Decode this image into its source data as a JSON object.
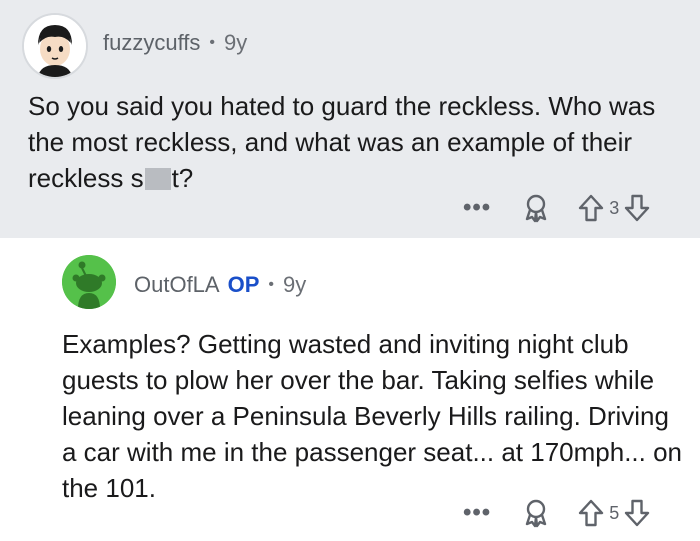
{
  "top_comment": {
    "author": "fuzzycuffs",
    "separator": "•",
    "age": "9y",
    "body_before": "So you said you hated to guard the reckless. Who was the most reckless, and what was an example of their reckless s",
    "body_after": "t?",
    "more_label": "•••",
    "vote_count": "3"
  },
  "reply_comment": {
    "author": "OutOfLA",
    "badge": "OP",
    "separator": "•",
    "age": "9y",
    "body": "Examples? Getting wasted and inviting night club guests to plow her over the bar. Taking selfies while leaning over a Peninsula Beverly Hills railing. Driving a car with me in the passenger seat... at 170mph... on the 101.",
    "more_label": "•••",
    "vote_count": "5"
  },
  "icons": {
    "award": "award-icon",
    "upvote": "upvote-arrow-icon",
    "downvote": "downvote-arrow-icon",
    "more": "more-options-icon"
  },
  "colors": {
    "top_background": "#e9ebee",
    "op_badge": "#1a4fc9",
    "reply_avatar": "#55c14a"
  }
}
